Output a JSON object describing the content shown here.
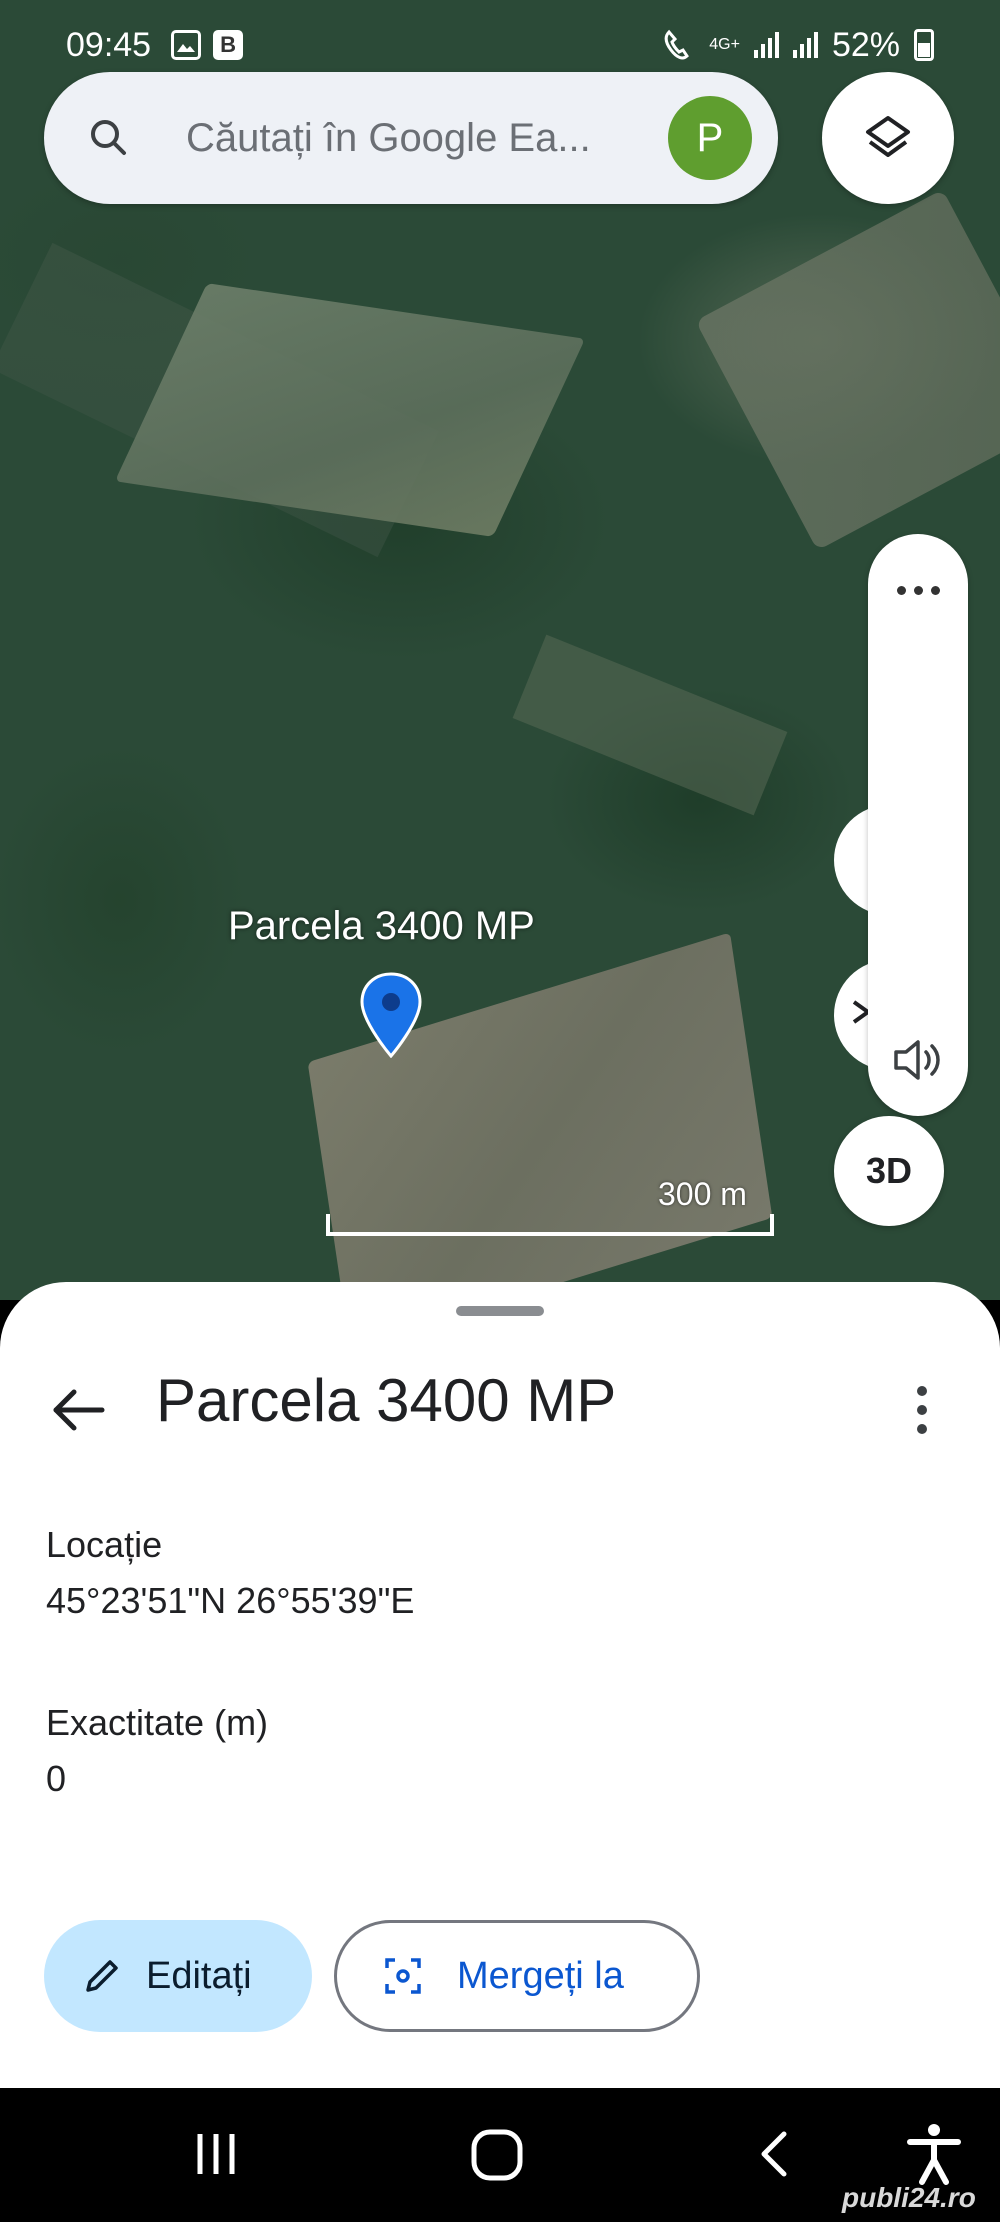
{
  "status_bar": {
    "time": "09:45",
    "battery": "52%",
    "network": "4G+"
  },
  "search": {
    "placeholder": "Căutați în Google Ea...",
    "avatar_letter": "P"
  },
  "map": {
    "pin_label": "Parcela 3400 MP",
    "scale_label": "300 m",
    "button_3d": "3D"
  },
  "sheet": {
    "title": "Parcela 3400 MP",
    "location_label": "Locație",
    "location_value": "45°23'51\"N 26°55'39\"E",
    "accuracy_label": "Exactitate (m)",
    "accuracy_value": "0",
    "edit_label": "Editați",
    "goto_label": "Mergeți la"
  },
  "watermark": "publi24.ro",
  "colors": {
    "accent": "#0b57d0",
    "edit_button_bg": "#c2e7ff",
    "pin": "#1a73e8",
    "avatar": "#5f9e2f"
  }
}
